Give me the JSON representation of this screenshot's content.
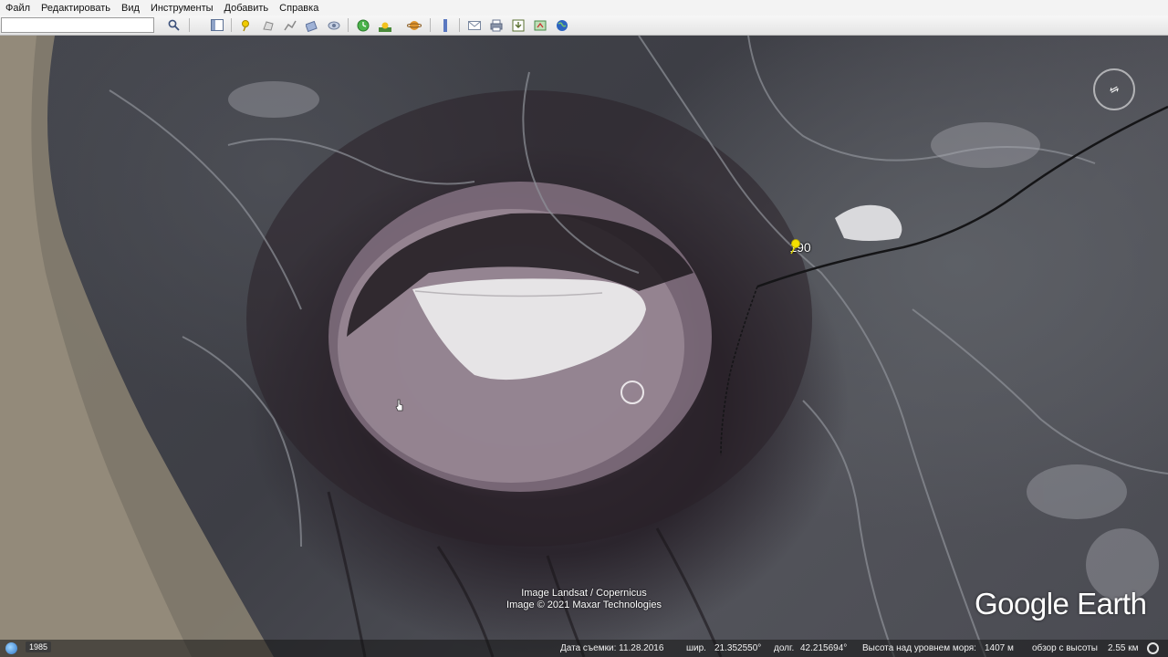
{
  "menu": {
    "items": [
      "Файл",
      "Редактировать",
      "Вид",
      "Инструменты",
      "Добавить",
      "Справка"
    ]
  },
  "toolbar": {
    "search_value": "",
    "buttons": [
      {
        "icon": "search-icon",
        "color": "#4a5f8a"
      },
      {
        "icon": "sidebar-toggle-icon",
        "color": "#6a7fa3"
      },
      {
        "icon": "add-placemark-icon",
        "color": "#e6c200"
      },
      {
        "icon": "add-polygon-icon",
        "color": "#9a9a9a"
      },
      {
        "icon": "add-path-icon",
        "color": "#9a9a9a"
      },
      {
        "icon": "add-image-overlay-icon",
        "color": "#5b6f99"
      },
      {
        "icon": "record-tour-icon",
        "color": "#7a8aa8"
      },
      {
        "icon": "historical-imagery-icon",
        "color": "#3ca23c"
      },
      {
        "icon": "sunlight-icon",
        "color": "#d6a21e"
      },
      {
        "icon": "switch-planet-icon",
        "color": "#d88a2a"
      },
      {
        "icon": "ruler-icon",
        "color": "#5a78c0"
      },
      {
        "icon": "email-icon",
        "color": "#8a98b0"
      },
      {
        "icon": "print-icon",
        "color": "#6a7690"
      },
      {
        "icon": "save-image-icon",
        "color": "#5a7030"
      },
      {
        "icon": "view-in-maps-icon",
        "color": "#4a8a4a"
      },
      {
        "icon": "earth-icon",
        "color": "#2d64c0"
      }
    ]
  },
  "map": {
    "placemark_label": "190",
    "compass_glyph": "⇋",
    "attribution_line1": "Image Landsat / Copernicus",
    "attribution_line2": "Image © 2021 Maxar Technologies",
    "logo_text": "Google Earth"
  },
  "status": {
    "year": "1985",
    "date_label": "Дата съемки: 11.28.2016",
    "lat_label": "шир.",
    "lat_value": "21.352550°",
    "lon_label": "долг.",
    "lon_value": "42.215694°",
    "elev_label": "Высота над уровнем моря:",
    "elev_value": "1407 м",
    "eye_label": "обзор с высоты",
    "eye_value": "2.55 км"
  }
}
